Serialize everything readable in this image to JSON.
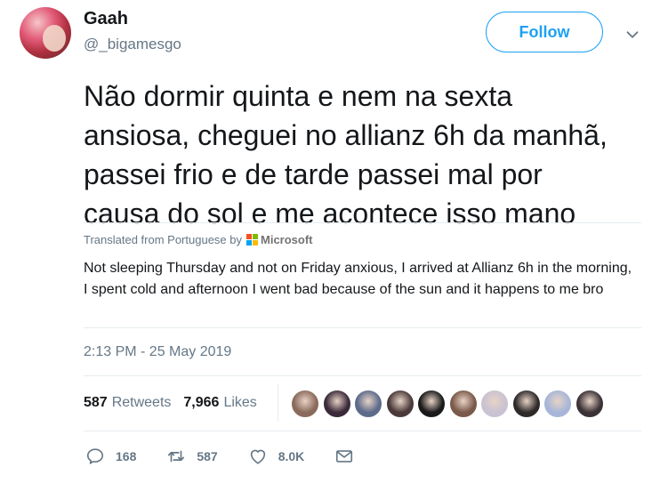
{
  "user": {
    "name": "Gaah",
    "handle": "@_bigamesgo"
  },
  "follow_label": "Follow",
  "tweet_lines": [
    "Não dormir quinta e nem na sexta",
    "ansiosa, cheguei no allianz 6h da manhã,",
    "passei frio e de tarde passei mal por",
    "causa do sol e me acontece isso mano"
  ],
  "translation": {
    "prefix": "Translated from Portuguese by",
    "provider": "Microsoft",
    "text": "Not sleeping Thursday and not on Friday anxious, I arrived at Allianz 6h in the morning, I spent cold and afternoon I went bad because of the sun and it happens to me bro"
  },
  "timestamp": "2:13 PM - 25 May 2019",
  "stats": {
    "retweets_count": "587",
    "retweets_label": "Retweets",
    "likes_count": "7,966",
    "likes_label": "Likes"
  },
  "likers_colors": [
    "#8a6a5c",
    "#3a2a3a",
    "#5d6a8a",
    "#4a3a3a",
    "#1a1a1a",
    "#7a5a4a",
    "#c9c2d2",
    "#2e2a2a",
    "#a7b6d8",
    "#3b3236"
  ],
  "actions": {
    "reply_count": "168",
    "retweet_count": "587",
    "like_count": "8.0K"
  },
  "colors": {
    "accent": "#1da1f2",
    "muted": "#657786",
    "divider": "#e6ecf0"
  }
}
